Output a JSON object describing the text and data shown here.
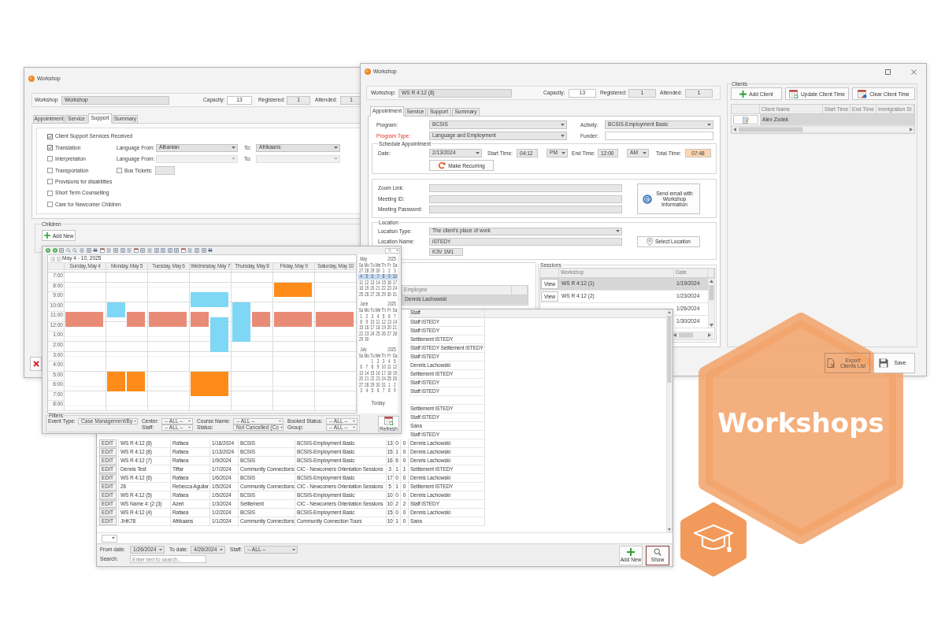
{
  "left_window": {
    "title": "Workshop",
    "header": {
      "workshop_label": "Workshop",
      "workshop": "Workshop",
      "capacity_label": "Capacity:",
      "capacity": "13",
      "registered_label": "Registered:",
      "registered": "1",
      "attended_label": "Attended:",
      "attended": "1"
    },
    "tabs": [
      {
        "label": "Appointment",
        "selected": false
      },
      {
        "label": "Service",
        "selected": false
      },
      {
        "label": "Support",
        "selected": true
      },
      {
        "label": "Summary",
        "selected": false
      }
    ],
    "support_options": [
      {
        "label": "Client Support Services Received",
        "checked": true
      },
      {
        "label": "Translation",
        "checked": true,
        "extra": {
          "kind": "languages",
          "from_label": "Language From:",
          "from": "Albanian",
          "to_label": "To:",
          "to": "Afrikaans",
          "disabled": false
        }
      },
      {
        "label": "Interpretation",
        "checked": false,
        "extra": {
          "kind": "languages",
          "from_label": "Language From:",
          "to_label": "To:",
          "disabled": true
        }
      },
      {
        "label": "Transportation",
        "checked": false,
        "extra": {
          "kind": "tickets",
          "label": "Bus Tickets:",
          "checked": false
        }
      },
      {
        "label": "Provisions for disabilities",
        "checked": false
      },
      {
        "label": "Short Term Counselling",
        "checked": false
      },
      {
        "label": "Care for Newcomer Children",
        "checked": false
      }
    ],
    "children": {
      "title": "Children",
      "add_button": "Add New"
    }
  },
  "right_window": {
    "title": "Workshop",
    "header": {
      "workshop_label": "Workshop:",
      "workshop": "WS R 4:12 (8)",
      "capacity_label": "Capacity:",
      "capacity": "13",
      "registered_label": "Registered:",
      "registered": "1",
      "attended_label": "Attended:",
      "attended": "1"
    },
    "tabs": [
      {
        "label": "Appointment",
        "selected": true
      },
      {
        "label": "Service",
        "selected": false
      },
      {
        "label": "Support",
        "selected": false
      },
      {
        "label": "Summary",
        "selected": false
      }
    ],
    "program": {
      "label": "Program:",
      "value": "BCSIS",
      "required": false
    },
    "activity": {
      "label": "Activity:",
      "value": "BCSIS-Employment Basic"
    },
    "program_type": {
      "label": "Program Type:",
      "value": "Language and Employment",
      "required": true
    },
    "funder": {
      "label": "Funder:"
    },
    "schedule": {
      "title": "Schedule Appointment",
      "date_label": "Date:",
      "date": "2/13/2024",
      "start_label": "Start Time:",
      "start": "04:12",
      "start_period": "PM",
      "end_label": "End Time:",
      "end": "12:00",
      "end_period": "AM",
      "total_label": "Total Time:",
      "total": "07:48",
      "recurring_button": "Make Recurring"
    },
    "meeting": {
      "fields": [
        {
          "label": "Zoom Link:"
        },
        {
          "label": "Meeting ID:"
        },
        {
          "label": "Meeting Password:"
        }
      ],
      "email_button": "Send email with Workshop Information"
    },
    "location": {
      "title": "Location",
      "type_label": "Location Type:",
      "type": "The client's place of work",
      "name_label": "Location Name:",
      "name": "iSTEDY",
      "postal": "K3V 1M1",
      "select_button": "Select Location"
    },
    "employees": {
      "column": "Employee",
      "rows": [
        {
          "name": "Dennis Lachowski",
          "selected": true
        }
      ]
    },
    "sessions": {
      "title": "Sessions",
      "columns": [
        "Workshop",
        "Date"
      ],
      "rows": [
        {
          "button": "View",
          "workshop": "WS R 4:12 (1)",
          "date": "1/19/2024",
          "selected": true
        },
        {
          "button": "View",
          "workshop": "WS R 4:12 (2)",
          "date": "1/23/2024",
          "selected": false
        },
        {
          "date": "1/26/2024",
          "selected": false
        },
        {
          "date": "1/30/2024",
          "selected": false
        }
      ]
    },
    "clients": {
      "title": "Clients",
      "buttons": [
        {
          "kind": "add",
          "label": "Add Client"
        },
        {
          "kind": "update",
          "label": "Update Client Time"
        },
        {
          "kind": "clear",
          "label": "Clear Client Time"
        }
      ],
      "columns": [
        "Client Name",
        "Start Time",
        "End Time",
        "Immigration St"
      ],
      "rows": [
        {
          "name": "Alex Zodek",
          "selected": true
        }
      ]
    },
    "footer_buttons": [
      {
        "kind": "export",
        "label": "Export Clients List",
        "disabled": true
      },
      {
        "kind": "save",
        "label": "Save",
        "disabled": false
      }
    ]
  },
  "calendar_window": {
    "range": "May 4 - 10, 2025",
    "times": [
      "7:00",
      "8:00",
      "9:00",
      "10:00",
      "11:00",
      "12:00",
      "1:00",
      "2:00",
      "3:00",
      "4:00",
      "5:00",
      "6:00",
      "7:00",
      "8:00"
    ],
    "days": [
      {
        "header": "Sunday, May 4",
        "events": [
          {
            "color": "#e88c78"
          }
        ]
      },
      {
        "header": "Monday, May 5",
        "events": [
          {
            "color": "#7dd7f5"
          },
          {
            "color": "#e88c78"
          },
          {
            "color": "#ff8c1a"
          },
          {
            "color": "#ff8c1a"
          }
        ]
      },
      {
        "header": "Tuesday, May 6",
        "events": [
          {
            "color": "#e88c78"
          }
        ]
      },
      {
        "header": "Wednesday, May 7",
        "events": [
          {
            "color": "#7dd7f5"
          },
          {
            "color": "#e88c78"
          },
          {
            "color": "#7dd7f5"
          },
          {
            "color": "#ff8c1a"
          }
        ]
      },
      {
        "header": "Thursday, May 8",
        "events": [
          {
            "color": "#7dd7f5"
          },
          {
            "color": "#e88c78"
          }
        ]
      },
      {
        "header": "Friday, May 9",
        "events": [
          {
            "color": "#ff8c1a"
          },
          {
            "color": "#e88c78"
          }
        ]
      },
      {
        "header": "Saturday, May 10",
        "events": [
          {
            "color": "#e88c78"
          }
        ]
      }
    ],
    "months": [
      {
        "month": "May",
        "year": "2025",
        "weekdays": [
          "Su",
          "Mo",
          "Tu",
          "We",
          "Th",
          "Fr",
          "Sa"
        ],
        "weeks": [
          {
            "days": [
              "27",
              "28",
              "29",
              "30",
              "1",
              "2",
              "3"
            ],
            "selected": false
          },
          {
            "days": [
              "4",
              "5",
              "6",
              "7",
              "8",
              "9",
              "10"
            ],
            "selected": true
          },
          {
            "days": [
              "11",
              "12",
              "13",
              "14",
              "15",
              "16",
              "17"
            ],
            "selected": false
          },
          {
            "days": [
              "18",
              "19",
              "20",
              "21",
              "22",
              "23",
              "24"
            ],
            "selected": false
          },
          {
            "days": [
              "25",
              "26",
              "27",
              "28",
              "29",
              "30",
              "31"
            ],
            "selected": false
          }
        ]
      },
      {
        "month": "June",
        "year": "2025",
        "weekdays": [
          "Su",
          "Mo",
          "Tu",
          "We",
          "Th",
          "Fr",
          "Sa"
        ],
        "weeks": [
          {
            "days": [
              "1",
              "2",
              "3",
              "4",
              "5",
              "6",
              "7"
            ],
            "selected": false
          },
          {
            "days": [
              "8",
              "9",
              "10",
              "11",
              "12",
              "13",
              "14"
            ],
            "selected": false
          },
          {
            "days": [
              "15",
              "16",
              "17",
              "18",
              "19",
              "20",
              "21"
            ],
            "selected": false
          },
          {
            "days": [
              "22",
              "23",
              "24",
              "25",
              "26",
              "27",
              "28"
            ],
            "selected": false
          },
          {
            "days": [
              "29",
              "30"
            ],
            "selected": false
          }
        ]
      },
      {
        "month": "July",
        "year": "2025",
        "weekdays": [
          "Su",
          "Mo",
          "Tu",
          "We",
          "Th",
          "Fr",
          "Sa"
        ],
        "weeks": [
          {
            "kind": "tail",
            "days": [
              "1",
              "2",
              "3",
              "4",
              "5"
            ],
            "selected": false
          },
          {
            "days": [
              "6",
              "7",
              "8",
              "9",
              "10",
              "11",
              "12"
            ],
            "selected": false
          },
          {
            "days": [
              "13",
              "14",
              "15",
              "16",
              "17",
              "18",
              "19"
            ],
            "selected": false
          },
          {
            "days": [
              "20",
              "21",
              "22",
              "23",
              "24",
              "25",
              "26"
            ],
            "selected": false
          },
          {
            "days": [
              "27",
              "28",
              "29",
              "30",
              "31",
              "1",
              "2"
            ],
            "selected": false
          },
          {
            "days": [
              "3",
              "4",
              "5",
              "6",
              "7",
              "8",
              "9"
            ],
            "selected": false
          }
        ]
      }
    ],
    "today_button": "Today",
    "filters": {
      "title": "Filters",
      "rows": [
        [
          {
            "label": "Event Type:",
            "value": "Case Management/By"
          },
          {
            "label": "Center:",
            "value": "-- ALL --"
          },
          {
            "label": "Course Name:",
            "value": "-- ALL --"
          },
          {
            "label": "Booked Status:",
            "value": "-- ALL --"
          }
        ],
        [
          "",
          {
            "label": "Staff:",
            "value": "-- ALL --"
          },
          {
            "label": "Status:",
            "value": "Not Cancelled (Co"
          },
          {
            "label": "Group:",
            "value": "-- ALL --"
          }
        ]
      ]
    },
    "refresh_button": "Refresh"
  },
  "list_window": {
    "header": {
      "staff": "Staff"
    },
    "rows": [
      {
        "staff": "Staff iSTEDY"
      },
      {
        "staff": "Staff iSTEDY"
      },
      {
        "staff": "Settlement iSTEDY"
      },
      {
        "staff": "Staff iSTEDY Settlement iSTEDY"
      },
      {
        "staff": "Staff iSTEDY"
      },
      {
        "staff": "Dennis Lachowski"
      },
      {
        "staff": "Settlement iSTEDY"
      },
      {
        "staff": "Staff iSTEDY"
      },
      {
        "staff": "Staff iSTEDY"
      },
      {},
      {
        "staff": "Settlement iSTEDY"
      },
      {
        "staff": "Staff iSTEDY"
      },
      {
        "staff": "Sana"
      },
      {
        "staff": "Staff iSTEDY"
      },
      {
        "button": "EDIT",
        "name": "WS R 4:12 (8)",
        "column_3": "Rafaea",
        "date": "1/16/2024",
        "program": "BCSIS",
        "activity": "BCSIS-Employment Basic",
        "column_7": "13",
        "column_8": "0",
        "column_9": "0",
        "staff": "Dennis Lachowski"
      },
      {
        "button": "EDIT",
        "name": "WS R 4:12 (8)",
        "column_3": "Rafaea",
        "date": "1/13/2024",
        "program": "BCSIS",
        "activity": "BCSIS-Employment Basic",
        "column_7": "15",
        "column_8": "1",
        "column_9": "0",
        "staff": "Dennis Lachowski"
      },
      {
        "button": "EDIT",
        "name": "WS R 4:12 (7)",
        "column_3": "Rafaea",
        "date": "1/9/2024",
        "program": "BCSIS",
        "activity": "BCSIS-Employment Basic",
        "column_7": "16",
        "column_8": "6",
        "column_9": "0",
        "staff": "Dennis Lachowski"
      },
      {
        "button": "EDIT",
        "name": "Dennis Test",
        "column_3": "Tiffar",
        "date": "1/7/2024",
        "program": "Community Connections",
        "activity": "CIC - Newcomers Orientation Sessions",
        "column_7": "3",
        "column_8": "1",
        "column_9": "1",
        "staff": "Settlement iSTEDY"
      },
      {
        "button": "EDIT",
        "name": "WS R 4:12 (6)",
        "column_3": "Rafaea",
        "date": "1/6/2024",
        "program": "BCSIS",
        "activity": "BCSIS-Employment Basic",
        "column_7": "17",
        "column_8": "0",
        "column_9": "0",
        "staff": "Dennis Lachowski"
      },
      {
        "button": "EDIT",
        "name": "26",
        "column_3": "Rebecca Aguilar",
        "date": "1/5/2024",
        "program": "Community Connections",
        "activity": "CIC - Newcomers Orientation Sessions",
        "column_7": "5",
        "column_8": "1",
        "column_9": "0",
        "staff": "Settlement iSTEDY"
      },
      {
        "button": "EDIT",
        "name": "WS R 4:12 (5)",
        "column_3": "Rafaea",
        "date": "1/5/2024",
        "program": "BCSIS",
        "activity": "BCSIS-Employment Basic",
        "column_7": "10",
        "column_8": "0",
        "column_9": "0",
        "staff": "Dennis Lachowski"
      },
      {
        "button": "EDIT",
        "name": "WS Name 4: (2 (3)",
        "column_3": "Azeri",
        "date": "1/3/2024",
        "program": "Settlement",
        "activity": "CIC - Newcomers Orientation Sessions",
        "column_7": "10",
        "column_8": "2",
        "column_9": "2",
        "staff": "Staff iSTEDY"
      },
      {
        "button": "EDIT",
        "name": "WS R 4:12 (4)",
        "column_3": "Rafaea",
        "date": "1/2/2024",
        "program": "BCSIS",
        "activity": "BCSIS-Employment Basic",
        "column_7": "15",
        "column_8": "0",
        "column_9": "0",
        "staff": "Dennis Lachowski"
      },
      {
        "button": "EDIT",
        "name": "JHK78",
        "column_3": "Afrikaans",
        "date": "1/1/2024",
        "program": "Community Connections",
        "activity": "Community Connection Tours",
        "column_7": "10",
        "column_8": "1",
        "column_9": "0",
        "staff": "Sana"
      }
    ],
    "filters": {
      "from_label": "From date:",
      "from": "1/26/2024",
      "to_label": "To date:",
      "to": "4/26/2024",
      "staff_label": "Staff:",
      "staff": "-- ALL --",
      "search_label": "Search:",
      "search_placeholder": "Enter text to search..."
    },
    "buttons": [
      {
        "kind": "add",
        "label": "Add New"
      },
      {
        "kind": "show",
        "label": "Show"
      }
    ]
  },
  "badge": {
    "title": "Workshops"
  }
}
